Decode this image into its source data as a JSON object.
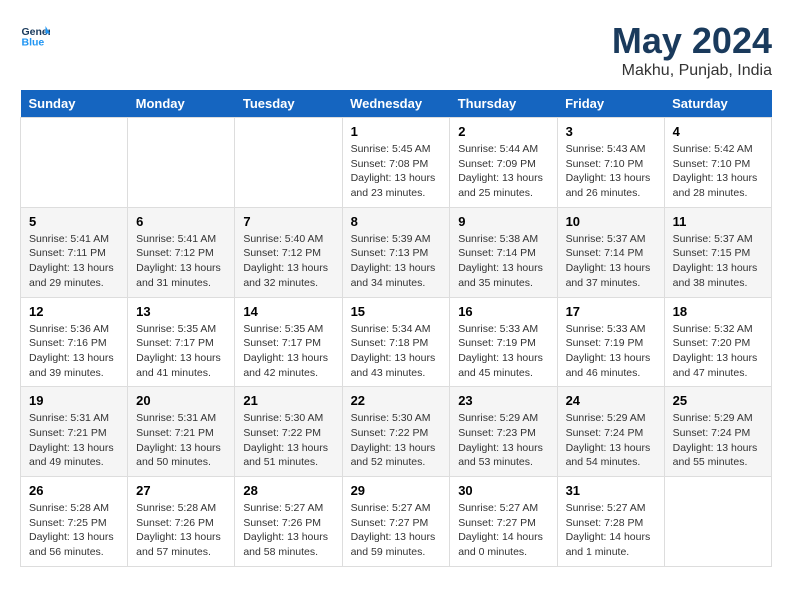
{
  "header": {
    "logo_line1": "General",
    "logo_line2": "Blue",
    "title": "May 2024",
    "subtitle": "Makhu, Punjab, India"
  },
  "calendar": {
    "days_of_week": [
      "Sunday",
      "Monday",
      "Tuesday",
      "Wednesday",
      "Thursday",
      "Friday",
      "Saturday"
    ],
    "weeks": [
      [
        {
          "day": "",
          "info": ""
        },
        {
          "day": "",
          "info": ""
        },
        {
          "day": "",
          "info": ""
        },
        {
          "day": "1",
          "info": "Sunrise: 5:45 AM\nSunset: 7:08 PM\nDaylight: 13 hours\nand 23 minutes."
        },
        {
          "day": "2",
          "info": "Sunrise: 5:44 AM\nSunset: 7:09 PM\nDaylight: 13 hours\nand 25 minutes."
        },
        {
          "day": "3",
          "info": "Sunrise: 5:43 AM\nSunset: 7:10 PM\nDaylight: 13 hours\nand 26 minutes."
        },
        {
          "day": "4",
          "info": "Sunrise: 5:42 AM\nSunset: 7:10 PM\nDaylight: 13 hours\nand 28 minutes."
        }
      ],
      [
        {
          "day": "5",
          "info": "Sunrise: 5:41 AM\nSunset: 7:11 PM\nDaylight: 13 hours\nand 29 minutes."
        },
        {
          "day": "6",
          "info": "Sunrise: 5:41 AM\nSunset: 7:12 PM\nDaylight: 13 hours\nand 31 minutes."
        },
        {
          "day": "7",
          "info": "Sunrise: 5:40 AM\nSunset: 7:12 PM\nDaylight: 13 hours\nand 32 minutes."
        },
        {
          "day": "8",
          "info": "Sunrise: 5:39 AM\nSunset: 7:13 PM\nDaylight: 13 hours\nand 34 minutes."
        },
        {
          "day": "9",
          "info": "Sunrise: 5:38 AM\nSunset: 7:14 PM\nDaylight: 13 hours\nand 35 minutes."
        },
        {
          "day": "10",
          "info": "Sunrise: 5:37 AM\nSunset: 7:14 PM\nDaylight: 13 hours\nand 37 minutes."
        },
        {
          "day": "11",
          "info": "Sunrise: 5:37 AM\nSunset: 7:15 PM\nDaylight: 13 hours\nand 38 minutes."
        }
      ],
      [
        {
          "day": "12",
          "info": "Sunrise: 5:36 AM\nSunset: 7:16 PM\nDaylight: 13 hours\nand 39 minutes."
        },
        {
          "day": "13",
          "info": "Sunrise: 5:35 AM\nSunset: 7:17 PM\nDaylight: 13 hours\nand 41 minutes."
        },
        {
          "day": "14",
          "info": "Sunrise: 5:35 AM\nSunset: 7:17 PM\nDaylight: 13 hours\nand 42 minutes."
        },
        {
          "day": "15",
          "info": "Sunrise: 5:34 AM\nSunset: 7:18 PM\nDaylight: 13 hours\nand 43 minutes."
        },
        {
          "day": "16",
          "info": "Sunrise: 5:33 AM\nSunset: 7:19 PM\nDaylight: 13 hours\nand 45 minutes."
        },
        {
          "day": "17",
          "info": "Sunrise: 5:33 AM\nSunset: 7:19 PM\nDaylight: 13 hours\nand 46 minutes."
        },
        {
          "day": "18",
          "info": "Sunrise: 5:32 AM\nSunset: 7:20 PM\nDaylight: 13 hours\nand 47 minutes."
        }
      ],
      [
        {
          "day": "19",
          "info": "Sunrise: 5:31 AM\nSunset: 7:21 PM\nDaylight: 13 hours\nand 49 minutes."
        },
        {
          "day": "20",
          "info": "Sunrise: 5:31 AM\nSunset: 7:21 PM\nDaylight: 13 hours\nand 50 minutes."
        },
        {
          "day": "21",
          "info": "Sunrise: 5:30 AM\nSunset: 7:22 PM\nDaylight: 13 hours\nand 51 minutes."
        },
        {
          "day": "22",
          "info": "Sunrise: 5:30 AM\nSunset: 7:22 PM\nDaylight: 13 hours\nand 52 minutes."
        },
        {
          "day": "23",
          "info": "Sunrise: 5:29 AM\nSunset: 7:23 PM\nDaylight: 13 hours\nand 53 minutes."
        },
        {
          "day": "24",
          "info": "Sunrise: 5:29 AM\nSunset: 7:24 PM\nDaylight: 13 hours\nand 54 minutes."
        },
        {
          "day": "25",
          "info": "Sunrise: 5:29 AM\nSunset: 7:24 PM\nDaylight: 13 hours\nand 55 minutes."
        }
      ],
      [
        {
          "day": "26",
          "info": "Sunrise: 5:28 AM\nSunset: 7:25 PM\nDaylight: 13 hours\nand 56 minutes."
        },
        {
          "day": "27",
          "info": "Sunrise: 5:28 AM\nSunset: 7:26 PM\nDaylight: 13 hours\nand 57 minutes."
        },
        {
          "day": "28",
          "info": "Sunrise: 5:27 AM\nSunset: 7:26 PM\nDaylight: 13 hours\nand 58 minutes."
        },
        {
          "day": "29",
          "info": "Sunrise: 5:27 AM\nSunset: 7:27 PM\nDaylight: 13 hours\nand 59 minutes."
        },
        {
          "day": "30",
          "info": "Sunrise: 5:27 AM\nSunset: 7:27 PM\nDaylight: 14 hours\nand 0 minutes."
        },
        {
          "day": "31",
          "info": "Sunrise: 5:27 AM\nSunset: 7:28 PM\nDaylight: 14 hours\nand 1 minute."
        },
        {
          "day": "",
          "info": ""
        }
      ]
    ]
  }
}
